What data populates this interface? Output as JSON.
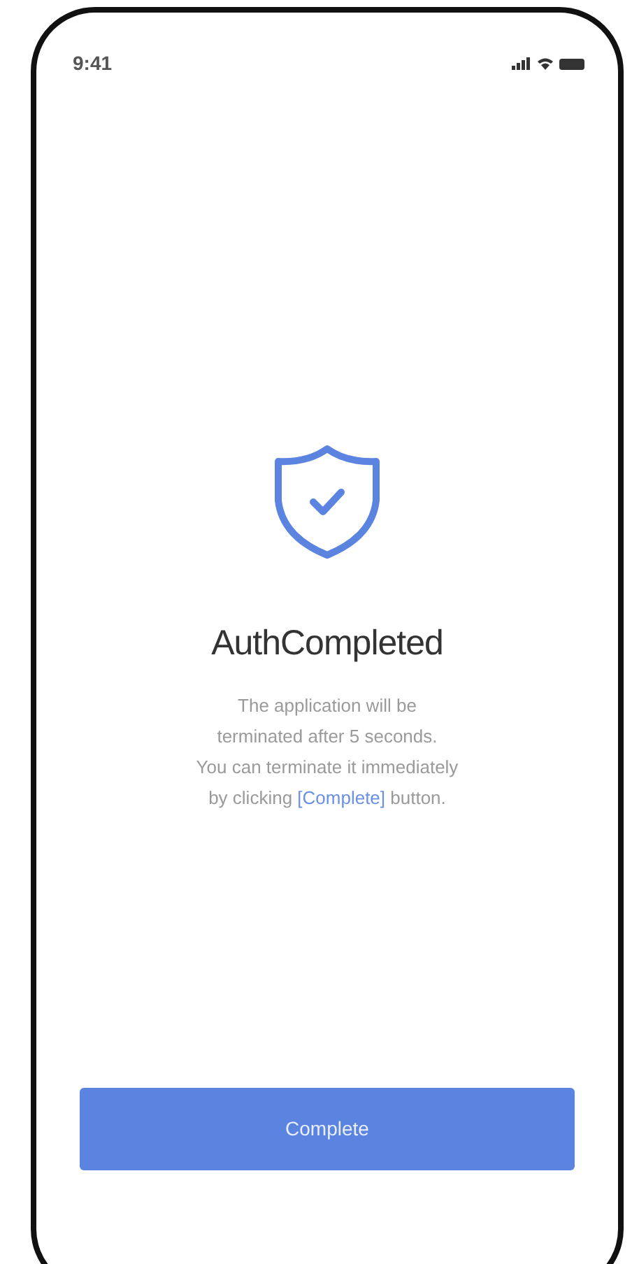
{
  "status_bar": {
    "time": "9:41"
  },
  "title": "AuthCompleted",
  "message": {
    "lines": [
      "The application will be",
      "terminated after 5 seconds.",
      "You can terminate it immediately"
    ],
    "last_before": "by clicking ",
    "link": "[Complete]",
    "last_after": " button."
  },
  "button": {
    "label": "Complete"
  }
}
